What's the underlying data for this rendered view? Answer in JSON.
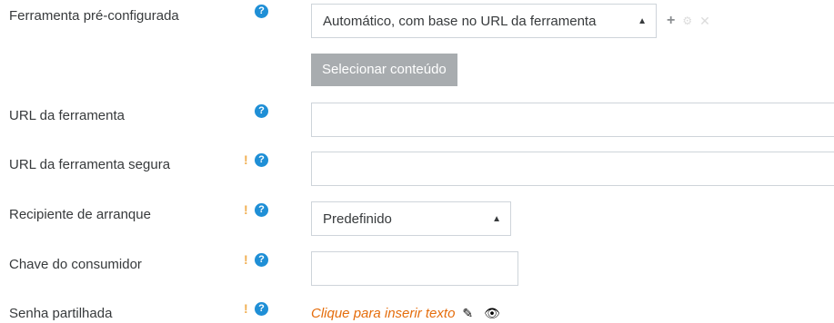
{
  "form": {
    "preconfigured_tool": {
      "label": "Ferramenta pré-configurada",
      "value": "Automático, com base no URL da ferramenta",
      "select_content_label": "Selecionar conteúdo"
    },
    "tool_url": {
      "label": "URL da ferramenta",
      "value": ""
    },
    "secure_tool_url": {
      "label": "URL da ferramenta segura",
      "value": ""
    },
    "launch_container": {
      "label": "Recipiente de arranque",
      "value": "Predefinido"
    },
    "consumer_key": {
      "label": "Chave do consumidor",
      "value": ""
    },
    "shared_secret": {
      "label": "Senha partilhada",
      "edit_text": "Clique para inserir texto"
    }
  },
  "icons": {
    "help": "question-circle-icon",
    "advanced": "exclamation-icon",
    "add": "plus-icon",
    "settings": "cog-icon",
    "delete": "x-icon",
    "edit": "pencil-icon",
    "reveal": "eye-icon"
  },
  "colors": {
    "help_icon": "#1f8fd6",
    "advanced_icon": "#f0ad4e",
    "link": "#e56d0c",
    "disabled_button": "#a8acaf"
  }
}
